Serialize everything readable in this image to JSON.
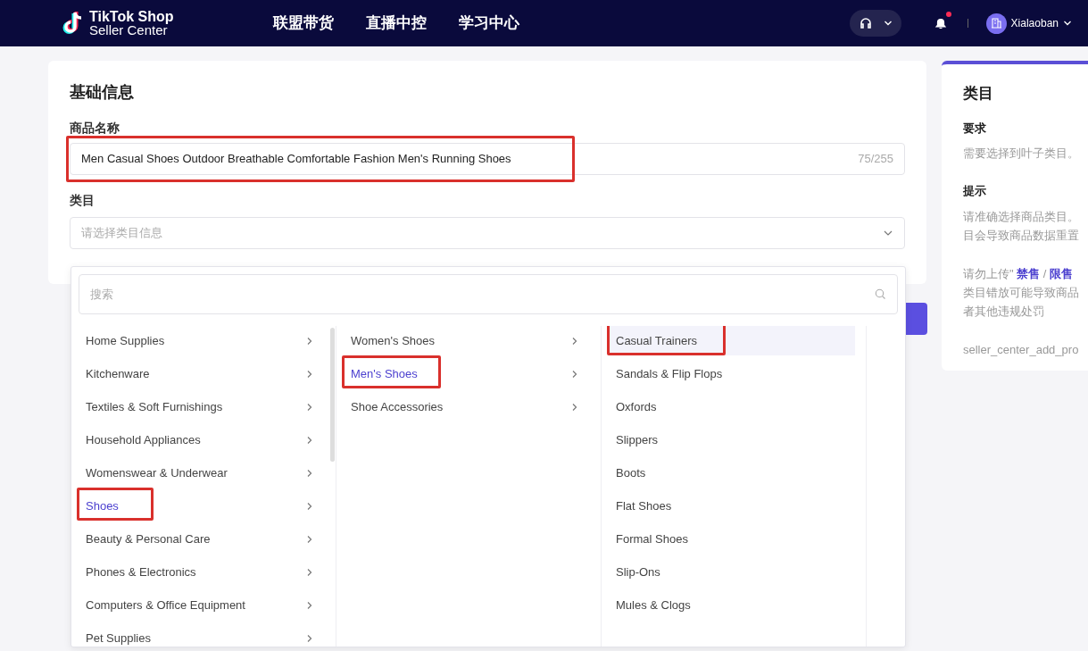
{
  "header": {
    "logo_title": "TikTok Shop",
    "logo_subtitle": "Seller Center",
    "nav": [
      {
        "label": "联盟带货"
      },
      {
        "label": "直播中控"
      },
      {
        "label": "学习中心"
      }
    ],
    "user": "Xialaoban",
    "notification_unread": true
  },
  "basic_info": {
    "title": "基础信息",
    "name_label": "商品名称",
    "name_value": "Men Casual Shoes Outdoor Breathable Comfortable Fashion Men's Running Shoes",
    "name_count": "75/255",
    "name_marked": true,
    "category_label": "类目",
    "category_placeholder": "请选择类目信息"
  },
  "category_dropdown": {
    "search_placeholder": "搜索",
    "columns": [
      {
        "items": [
          {
            "label": "Home Supplies",
            "selected": false,
            "marked": false,
            "has_children": true
          },
          {
            "label": "Kitchenware",
            "selected": false,
            "marked": false,
            "has_children": true
          },
          {
            "label": "Textiles & Soft Furnishings",
            "selected": false,
            "marked": false,
            "has_children": true
          },
          {
            "label": "Household Appliances",
            "selected": false,
            "marked": false,
            "has_children": true
          },
          {
            "label": "Womenswear & Underwear",
            "selected": false,
            "marked": false,
            "has_children": true
          },
          {
            "label": "Shoes",
            "selected": true,
            "marked": true,
            "has_children": true
          },
          {
            "label": "Beauty & Personal Care",
            "selected": false,
            "marked": false,
            "has_children": true
          },
          {
            "label": "Phones & Electronics",
            "selected": false,
            "marked": false,
            "has_children": true
          },
          {
            "label": "Computers & Office Equipment",
            "selected": false,
            "marked": false,
            "has_children": true
          },
          {
            "label": "Pet Supplies",
            "selected": false,
            "marked": false,
            "has_children": true
          }
        ]
      },
      {
        "items": [
          {
            "label": "Women's Shoes",
            "selected": false,
            "marked": false,
            "has_children": true
          },
          {
            "label": "Men's Shoes",
            "selected": true,
            "marked": true,
            "has_children": true
          },
          {
            "label": "Shoe Accessories",
            "selected": false,
            "marked": false,
            "has_children": true
          }
        ]
      },
      {
        "items": [
          {
            "label": "Casual Trainers",
            "selected": true,
            "marked": true,
            "has_children": false
          },
          {
            "label": "Sandals & Flip Flops",
            "selected": false,
            "marked": false,
            "has_children": false
          },
          {
            "label": "Oxfords",
            "selected": false,
            "marked": false,
            "has_children": false
          },
          {
            "label": "Slippers",
            "selected": false,
            "marked": false,
            "has_children": false
          },
          {
            "label": "Boots",
            "selected": false,
            "marked": false,
            "has_children": false
          },
          {
            "label": "Flat Shoes",
            "selected": false,
            "marked": false,
            "has_children": false
          },
          {
            "label": "Formal Shoes",
            "selected": false,
            "marked": false,
            "has_children": false
          },
          {
            "label": "Slip-Ons",
            "selected": false,
            "marked": false,
            "has_children": false
          },
          {
            "label": "Mules & Clogs",
            "selected": false,
            "marked": false,
            "has_children": false
          }
        ]
      }
    ]
  },
  "help_panel": {
    "title": "类目",
    "sections": [
      {
        "heading": "要求",
        "lines": [
          "需要选择到叶子类目。"
        ]
      },
      {
        "heading": "提示",
        "lines": [
          "请准确选择商品类目。",
          "目会导致商品数据重置"
        ]
      },
      {
        "lines": [
          "请勿上传\" **禁售** / **限售**",
          "类目错放可能导致商品",
          "者其他违规处罚"
        ]
      },
      {
        "lines": [
          "seller_center_add_pro"
        ]
      }
    ]
  }
}
